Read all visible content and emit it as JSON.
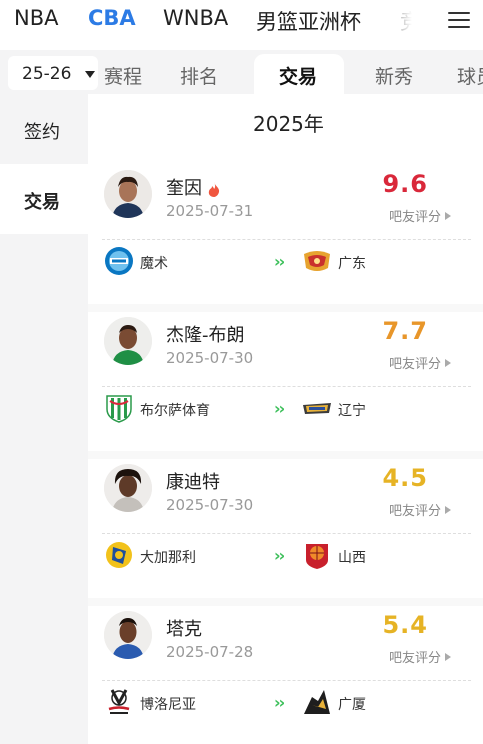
{
  "leagues": [
    "NBA",
    "CBA",
    "WNBA",
    "男篮亚洲杯",
    "竞"
  ],
  "active_league": "CBA",
  "season_selector": "25-26",
  "subtabs": [
    "赛程",
    "排名",
    "交易",
    "新秀",
    "球员"
  ],
  "active_subtab": "交易",
  "side_nav": [
    "签约",
    "交易"
  ],
  "active_side": "交易",
  "year_heading": "2025年",
  "score_label": "吧友评分",
  "colors": {
    "accent": "#2c7be5",
    "score_red": "#d9283a",
    "score_orange": "#e8962a",
    "score_gold": "#e6b325",
    "arrow_green": "#3cbf5a"
  },
  "trades": [
    {
      "player": "奎因",
      "hot": true,
      "date": "2025-07-31",
      "score": "9.6",
      "score_color": "#d9283a",
      "from_team": "魔术",
      "to_team": "广东",
      "from_icon": "magic-logo-icon",
      "to_icon": "guangdong-logo-icon"
    },
    {
      "player": "杰隆-布朗",
      "hot": false,
      "date": "2025-07-30",
      "score": "7.7",
      "score_color": "#e8962a",
      "from_team": "布尔萨体育",
      "to_team": "辽宁",
      "from_icon": "bursaspor-logo-icon",
      "to_icon": "liaoning-logo-icon"
    },
    {
      "player": "康迪特",
      "hot": false,
      "date": "2025-07-30",
      "score": "4.5",
      "score_color": "#e6b325",
      "from_team": "大加那利",
      "to_team": "山西",
      "from_icon": "gran-canaria-logo-icon",
      "to_icon": "shanxi-logo-icon"
    },
    {
      "player": "塔克",
      "hot": false,
      "date": "2025-07-28",
      "score": "5.4",
      "score_color": "#e6b325",
      "from_team": "博洛尼亚",
      "to_team": "广厦",
      "from_icon": "bologna-logo-icon",
      "to_icon": "guangsha-logo-icon"
    }
  ]
}
